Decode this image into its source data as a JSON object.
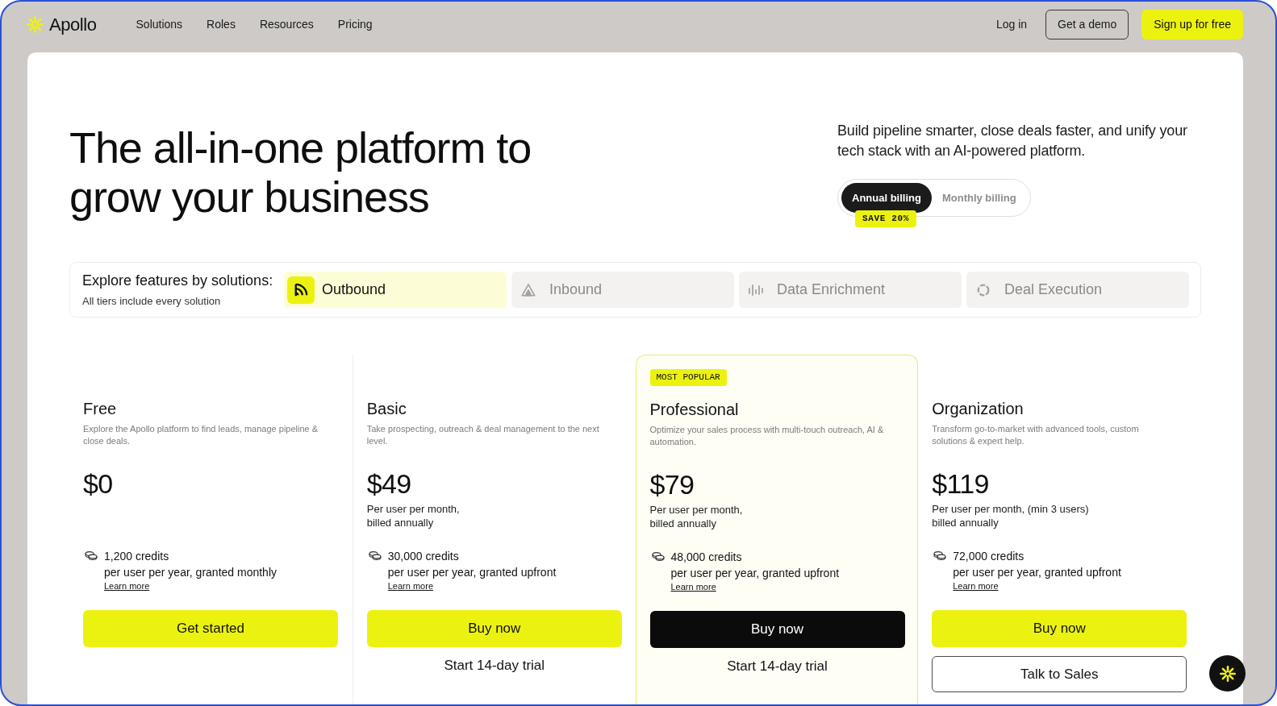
{
  "nav": {
    "logo": "Apollo",
    "links": [
      "Solutions",
      "Roles",
      "Resources",
      "Pricing"
    ],
    "login": "Log in",
    "demo_button": "Get a demo",
    "signup_button": "Sign up for free"
  },
  "hero": {
    "heading_lines": [
      "The all-in-one platform to",
      "grow your business"
    ],
    "subtitle": "Build pipeline smarter, close deals faster, and unify your tech stack with an AI-powered platform.",
    "billing": {
      "options": [
        {
          "label": "Annual billing",
          "selected": true
        },
        {
          "label": "Monthly billing",
          "selected": false
        }
      ],
      "badge": "SAVE 20%"
    }
  },
  "solutions": {
    "title": "Explore features by solutions:",
    "subtitle": "All tiers include every solution",
    "tabs": [
      {
        "label": "Outbound",
        "selected": true
      },
      {
        "label": "Inbound",
        "selected": false
      },
      {
        "label": "Data Enrichment",
        "selected": false
      },
      {
        "label": "Deal Execution",
        "selected": false
      }
    ]
  },
  "plans": [
    {
      "name": "Free",
      "description": "Explore the Apollo platform to find leads, manage pipeline & close deals.",
      "price": "$0",
      "credits": "1,200 credits",
      "credits_note": "per user per year, granted monthly",
      "credits_link": "Learn more",
      "highlighted": false,
      "primary_button": "Get started"
    },
    {
      "name": "Basic",
      "description": "Take prospecting, outreach & deal management to the next level.",
      "price": "$49",
      "price_note_lines": [
        "Per user per month,",
        "billed annually"
      ],
      "credits": "30,000 credits",
      "credits_note": "per user per year, granted upfront",
      "credits_link": "Learn more",
      "highlighted": false,
      "primary_button": "Buy now",
      "secondary": {
        "kind": "link",
        "label": "Start 14-day trial"
      }
    },
    {
      "name": "Professional",
      "badge": "MOST POPULAR",
      "description": "Optimize your sales process with multi-touch outreach, AI & automation.",
      "price": "$79",
      "price_note_lines": [
        "Per user per month,",
        "billed annually"
      ],
      "credits": "48,000 credits",
      "credits_note": "per user per year, granted upfront",
      "credits_link": "Learn more",
      "highlighted": true,
      "primary_button": "Buy now",
      "secondary": {
        "kind": "link",
        "label": "Start 14-day trial"
      }
    },
    {
      "name": "Organization",
      "description": "Transform go-to-market with advanced tools, custom solutions & expert help.",
      "price": "$119",
      "price_note_lines": [
        "Per user per month, (min 3 users)",
        "billed annually"
      ],
      "credits": "72,000 credits",
      "credits_note": "per user per year, granted upfront",
      "credits_link": "Learn more",
      "highlighted": false,
      "primary_button": "Buy now",
      "secondary": {
        "kind": "outline",
        "label": "Talk to Sales"
      }
    }
  ]
}
